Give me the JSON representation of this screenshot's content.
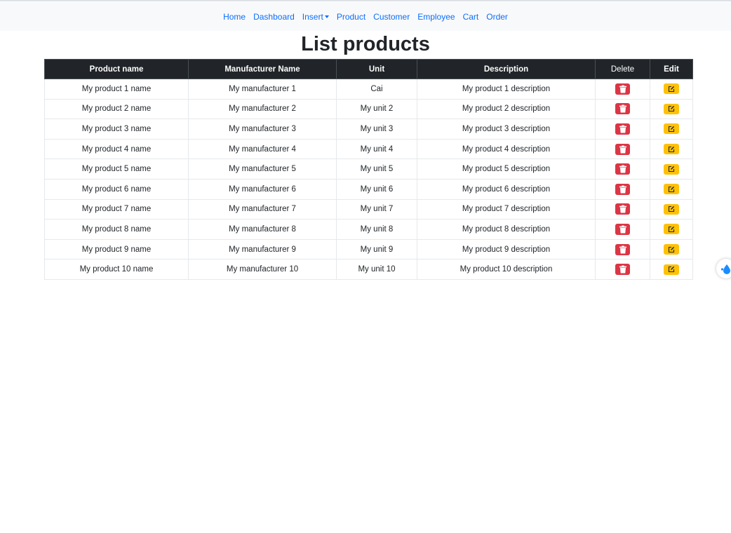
{
  "nav": {
    "items": [
      {
        "label": "Home"
      },
      {
        "label": "Dashboard"
      },
      {
        "label": "Insert",
        "dropdown": true
      },
      {
        "label": "Product"
      },
      {
        "label": "Customer"
      },
      {
        "label": "Employee"
      },
      {
        "label": "Cart"
      },
      {
        "label": "Order"
      }
    ]
  },
  "page": {
    "title": "List products"
  },
  "table": {
    "headers": [
      "Product name",
      "Manufacturer Name",
      "Unit",
      "Description",
      "Delete",
      "Edit"
    ],
    "rows": [
      {
        "name": "My product 1 name",
        "manufacturer": "My manufacturer 1",
        "unit": "Cai",
        "description": "My product 1 description"
      },
      {
        "name": "My product 2 name",
        "manufacturer": "My manufacturer 2",
        "unit": "My unit 2",
        "description": "My product 2 description"
      },
      {
        "name": "My product 3 name",
        "manufacturer": "My manufacturer 3",
        "unit": "My unit 3",
        "description": "My product 3 description"
      },
      {
        "name": "My product 4 name",
        "manufacturer": "My manufacturer 4",
        "unit": "My unit 4",
        "description": "My product 4 description"
      },
      {
        "name": "My product 5 name",
        "manufacturer": "My manufacturer 5",
        "unit": "My unit 5",
        "description": "My product 5 description"
      },
      {
        "name": "My product 6 name",
        "manufacturer": "My manufacturer 6",
        "unit": "My unit 6",
        "description": "My product 6 description"
      },
      {
        "name": "My product 7 name",
        "manufacturer": "My manufacturer 7",
        "unit": "My unit 7",
        "description": "My product 7 description"
      },
      {
        "name": "My product 8 name",
        "manufacturer": "My manufacturer 8",
        "unit": "My unit 8",
        "description": "My product 8 description"
      },
      {
        "name": "My product 9 name",
        "manufacturer": "My manufacturer 9",
        "unit": "My unit 9",
        "description": "My product 9 description"
      },
      {
        "name": "My product 10 name",
        "manufacturer": "My manufacturer 10",
        "unit": "My unit 10",
        "description": "My product 10 description"
      }
    ]
  },
  "icons": {
    "delete": "trash-icon",
    "edit": "edit-icon",
    "widget": "droplet-icon"
  },
  "colors": {
    "nav_link": "#0d6efd",
    "header_bg": "#212529",
    "delete_button": "#dc3545",
    "edit_button": "#ffc107"
  }
}
